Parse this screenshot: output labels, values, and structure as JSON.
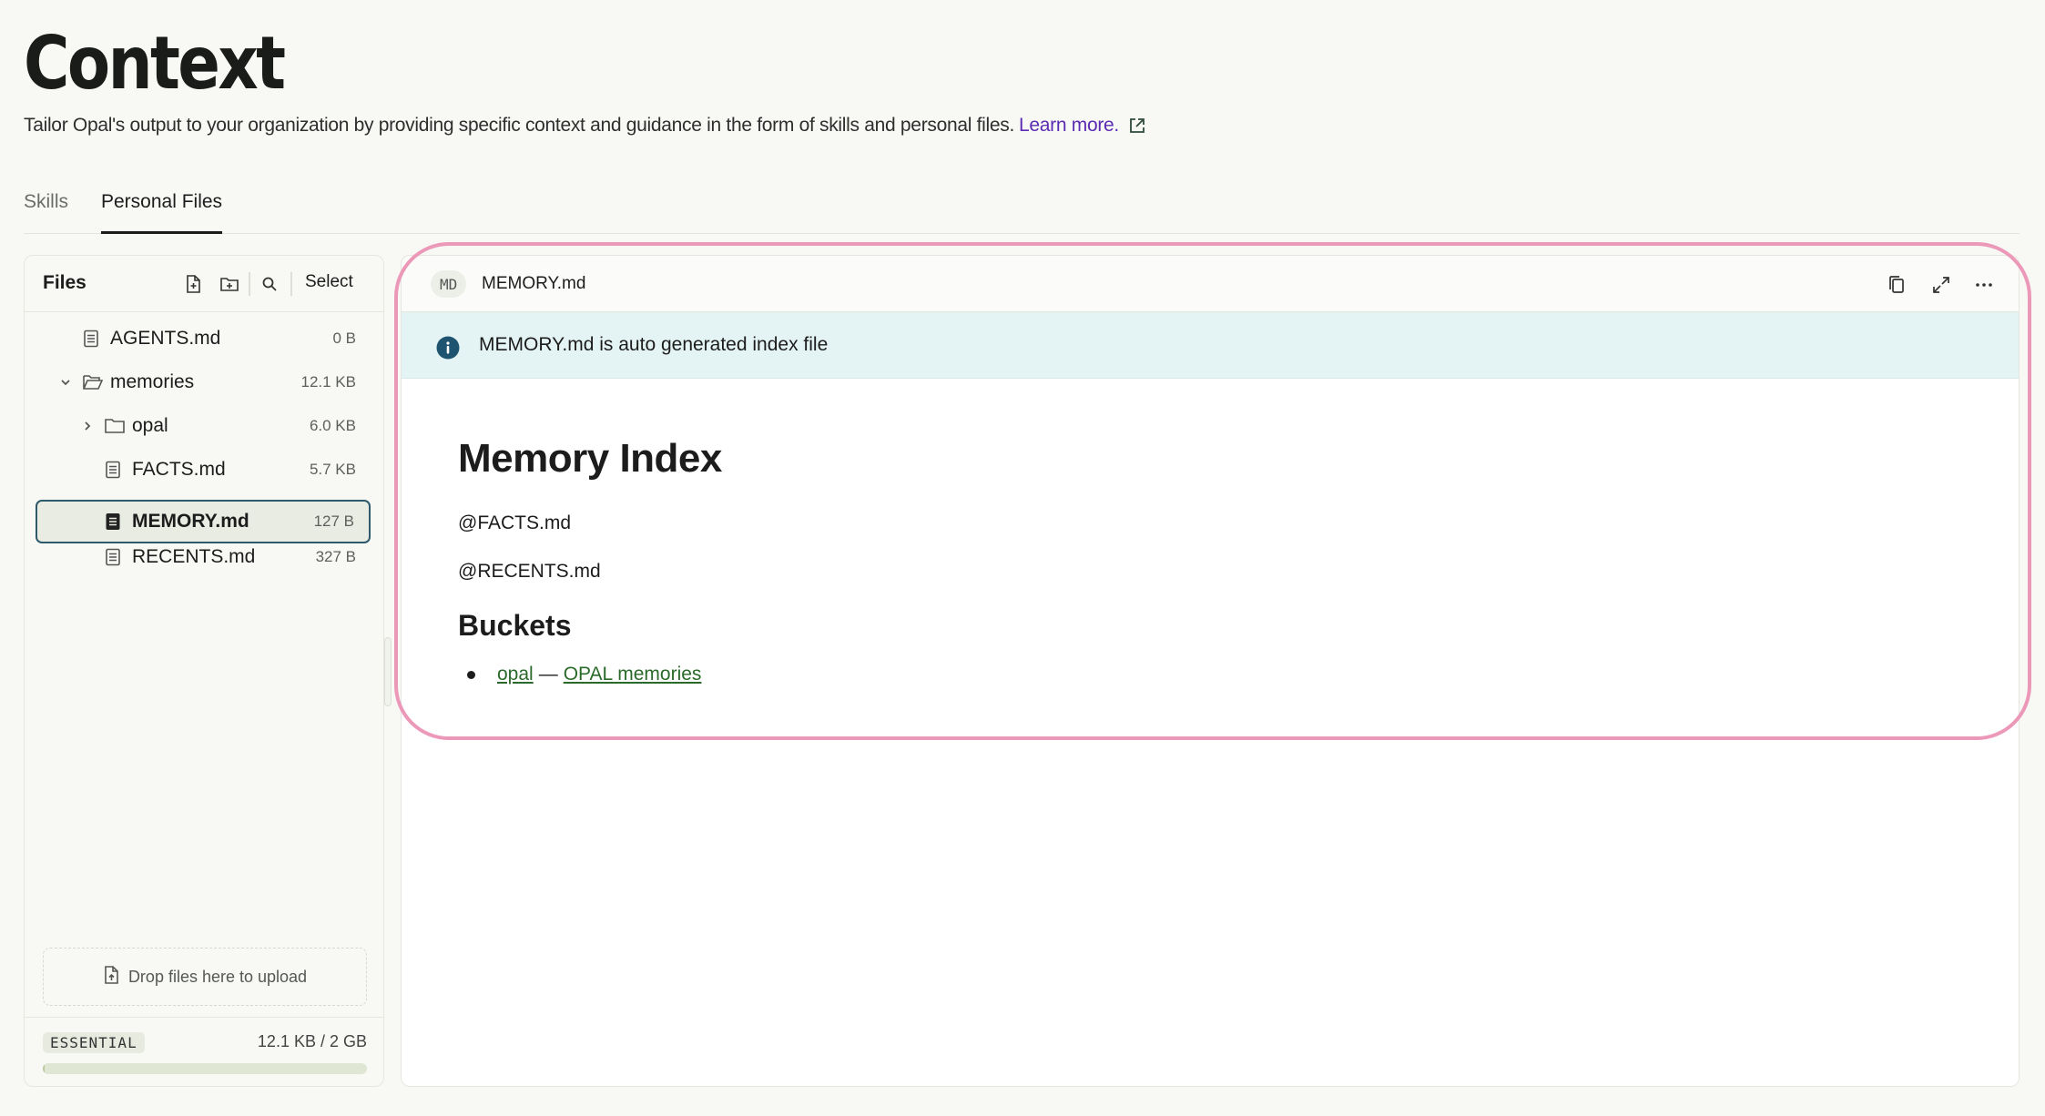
{
  "page": {
    "title": "Context",
    "description": "Tailor Opal's output to your organization by providing specific context and guidance in the form of skills and personal files.",
    "learn_more": "Learn more."
  },
  "tabs": [
    {
      "label": "Skills",
      "active": false
    },
    {
      "label": "Personal Files",
      "active": true
    }
  ],
  "files_panel": {
    "title": "Files",
    "select_label": "Select",
    "header_icons": [
      "new-file-icon",
      "new-folder-icon",
      "search-icon"
    ],
    "tree": [
      {
        "name": "AGENTS.md",
        "size": "0 B",
        "type": "file",
        "depth": 0
      },
      {
        "name": "memories",
        "size": "12.1 KB",
        "type": "folder",
        "expanded": true,
        "depth": 0
      },
      {
        "name": "opal",
        "size": "6.0 KB",
        "type": "folder",
        "expanded": false,
        "depth": 1
      },
      {
        "name": "FACTS.md",
        "size": "5.7 KB",
        "type": "file",
        "depth": 1
      },
      {
        "name": "MEMORY.md",
        "size": "127 B",
        "type": "file",
        "depth": 1,
        "selected": true
      },
      {
        "name": "RECENTS.md",
        "size": "327 B",
        "type": "file",
        "depth": 1
      }
    ],
    "drop_zone": "Drop files here to upload",
    "plan_badge": "ESSENTIAL",
    "usage_text": "12.1 KB / 2 GB",
    "usage_fraction": 0.006
  },
  "viewer": {
    "type_badge": "MD",
    "filename": "MEMORY.md",
    "header_icons": [
      "copy-icon",
      "expand-icon",
      "more-icon"
    ],
    "info_banner": "MEMORY.md is auto generated index file",
    "document": {
      "heading": "Memory Index",
      "paragraphs": [
        "@FACTS.md",
        "@RECENTS.md"
      ],
      "subheading": "Buckets",
      "list_items": [
        {
          "link1": "opal",
          "separator": "—",
          "link2": "OPAL memories"
        }
      ]
    }
  },
  "colors": {
    "accent_link": "#5b2bb3",
    "selection_border": "#2e5a6c",
    "info_banner_bg": "#e4f3f3",
    "highlight_ring": "#ec98b8",
    "doc_link": "#2a6a2a"
  }
}
